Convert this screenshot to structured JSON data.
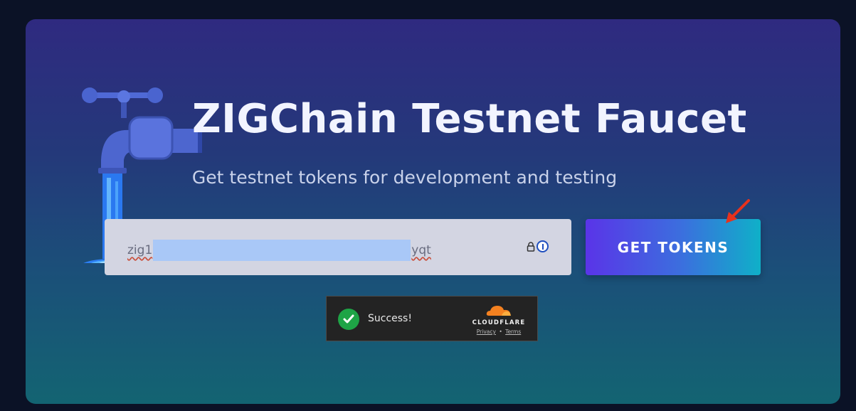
{
  "page": {
    "title": "ZIGChain Testnet Faucet",
    "subtitle": "Get testnet tokens for development and testing"
  },
  "form": {
    "address_prefix": "zig1",
    "address_suffix": "yqt",
    "submit_label": "GET TOKENS"
  },
  "captcha": {
    "status": "Success!",
    "brand": "CLOUDFLARE",
    "privacy_label": "Privacy",
    "separator": "•",
    "terms_label": "Terms"
  },
  "colors": {
    "accent_start": "#5a34e8",
    "accent_end": "#0fb0c8",
    "success": "#1ea446",
    "cloudflare_orange": "#f48120",
    "annotation_arrow": "#e8321c"
  },
  "icons": [
    "faucet-illustration",
    "lock-icon",
    "password-manager-icon",
    "check-icon",
    "cloudflare-logo",
    "red-arrow"
  ]
}
